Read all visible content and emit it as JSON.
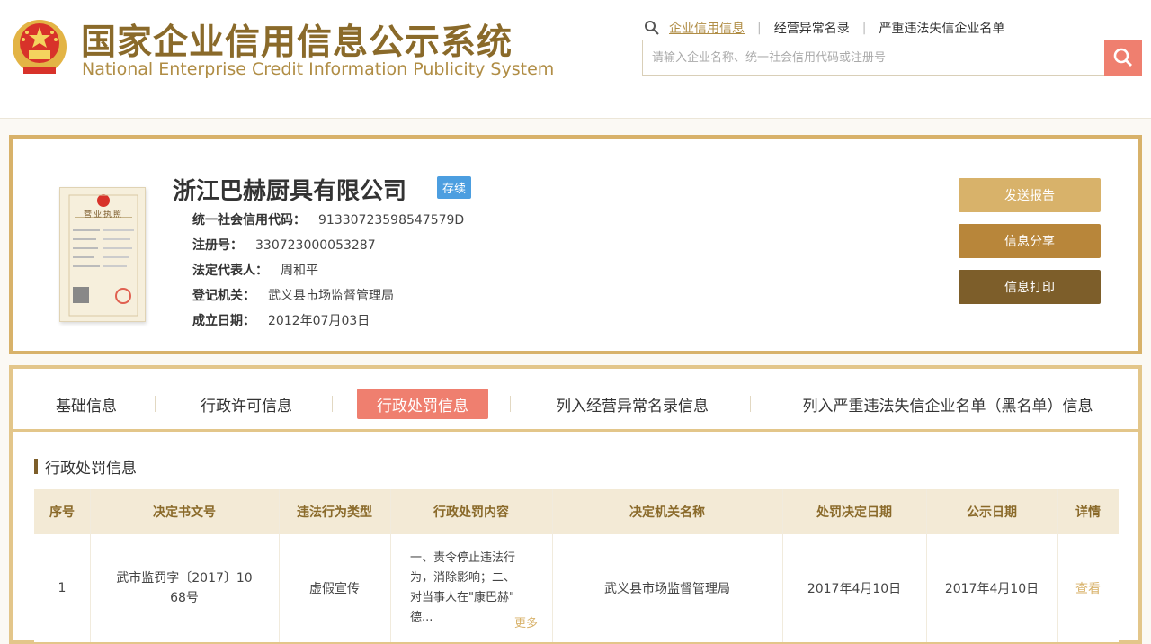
{
  "header": {
    "title_cn": "国家企业信用信息公示系统",
    "title_en": "National Enterprise Credit Information Publicity System",
    "search_tabs": [
      "企业信用信息",
      "经营异常名录",
      "严重违法失信企业名单"
    ],
    "search_placeholder": "请输入企业名称、统一社会信用代码或注册号"
  },
  "company": {
    "name": "浙江巴赫厨具有限公司",
    "status": "存续",
    "credit_code_label": "统一社会信用代码：",
    "credit_code": "91330723598547579D",
    "reg_no_label": "注册号：",
    "reg_no": "330723000053287",
    "legal_rep_label": "法定代表人：",
    "legal_rep": "周和平",
    "authority_label": "登记机关：",
    "authority": "武义县市场监督管理局",
    "founded_label": "成立日期：",
    "founded": "2012年07月03日",
    "license_title": "营业执照"
  },
  "actions": {
    "report": "发送报告",
    "share": "信息分享",
    "print": "信息打印"
  },
  "tabs": [
    "基础信息",
    "行政许可信息",
    "行政处罚信息",
    "列入经营异常名录信息",
    "列入严重违法失信企业名单（黑名单）信息"
  ],
  "active_tab": "行政处罚信息",
  "section_title": "行政处罚信息",
  "table": {
    "headers": [
      "序号",
      "决定书文号",
      "违法行为类型",
      "行政处罚内容",
      "决定机关名称",
      "处罚决定日期",
      "公示日期",
      "详情"
    ],
    "rows": [
      {
        "no": "1",
        "doc_line1": "武市监罚字〔2017〕10",
        "doc_line2": "68号",
        "type": "虚假宣传",
        "content_line1": "一、责令停止违法行",
        "content_line2": "为，消除影响；二、",
        "content_line3": "对当事人在\"康巴赫\"",
        "content_line4": "德...",
        "more": "更多",
        "authority": "武义县市场监督管理局",
        "decision_date": "2017年4月10日",
        "publish_date": "2017年4月10日",
        "detail": "查看"
      }
    ]
  },
  "colors": {
    "gold": "#d8b26a",
    "brown": "#b8863a",
    "dark_brown": "#7d5e2a",
    "active_tab": "#ef7f6f",
    "status_blue": "#4c9ee0"
  }
}
